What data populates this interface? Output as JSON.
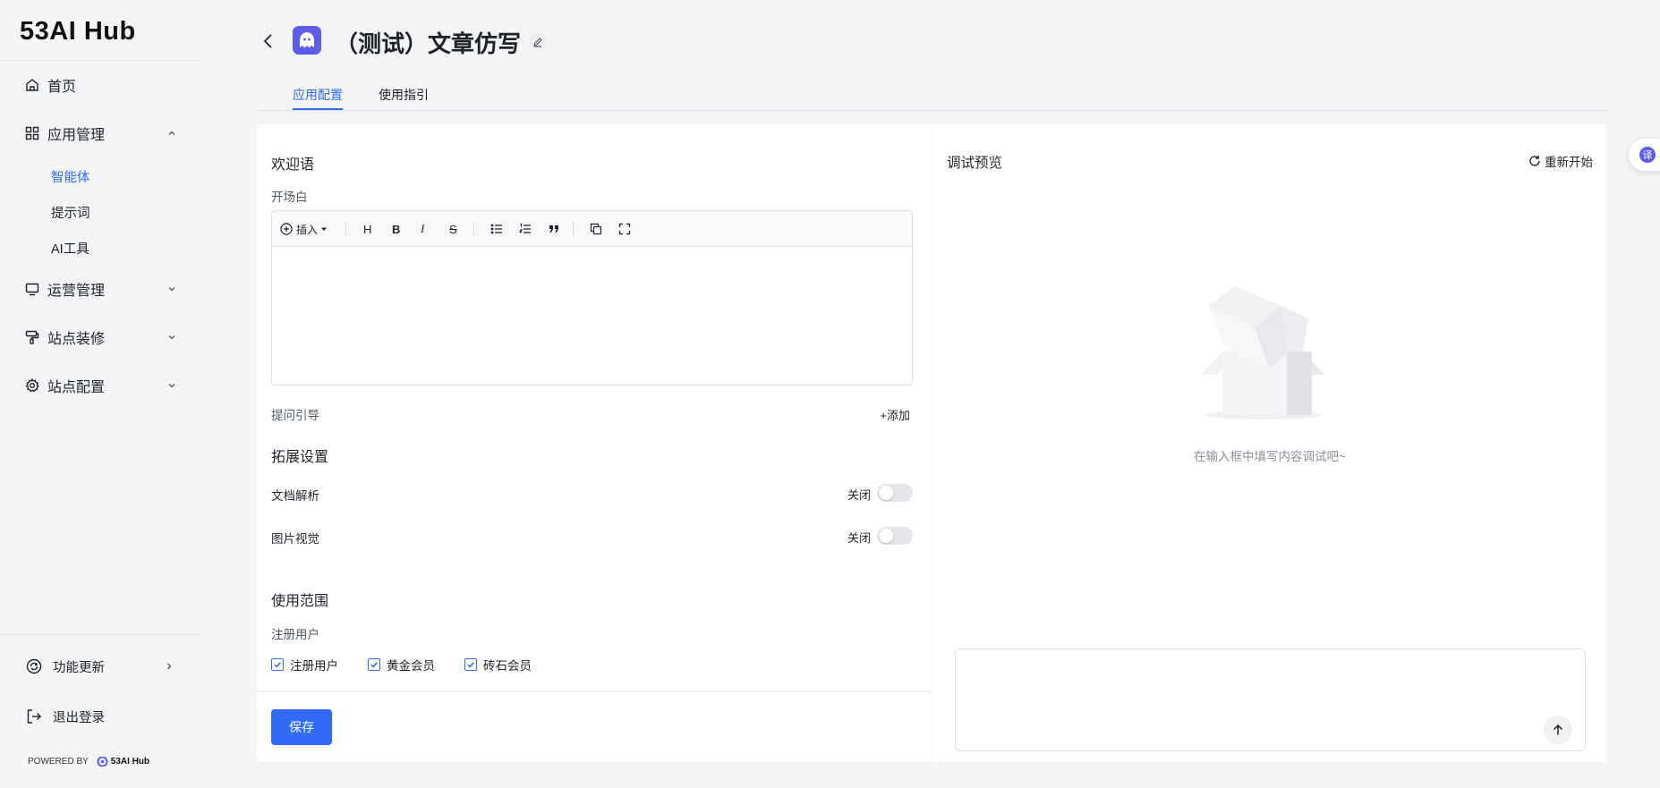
{
  "sidebar": {
    "logo": "53AI Hub",
    "items": [
      {
        "label": "首页",
        "icon": "home-icon"
      },
      {
        "label": "应用管理",
        "icon": "grid-icon",
        "expanded": true
      },
      {
        "label": "运营管理",
        "icon": "monitor-icon",
        "expanded": false
      },
      {
        "label": "站点装修",
        "icon": "paint-roller-icon",
        "expanded": false
      },
      {
        "label": "站点配置",
        "icon": "gear-icon",
        "expanded": false
      }
    ],
    "sub_items": [
      {
        "label": "智能体",
        "active": true
      },
      {
        "label": "提示词",
        "active": false
      },
      {
        "label": "AI工具",
        "active": false
      }
    ],
    "footer": {
      "updates_label": "功能更新",
      "logout_label": "退出登录",
      "powered_by": "POWERED BY",
      "powered_brand": "53AI Hub"
    }
  },
  "header": {
    "title": "（测试）文章仿写",
    "tabs": [
      {
        "label": "应用配置",
        "active": true
      },
      {
        "label": "使用指引",
        "active": false
      }
    ]
  },
  "config": {
    "welcome_title": "欢迎语",
    "opening_label": "开场白",
    "toolbar": {
      "insert_label": "插入",
      "heading": "H",
      "bold": "B",
      "italic": "I",
      "strike": "S"
    },
    "editor_value": "",
    "question_guide_label": "提问引导",
    "add_label": "+添加",
    "extension_title": "拓展设置",
    "doc_parse_label": "文档解析",
    "doc_parse_state": "关闭",
    "image_vision_label": "图片视觉",
    "image_vision_state": "关闭",
    "scope_title": "使用范围",
    "registered_users_label": "注册用户",
    "members": [
      {
        "label": "注册用户",
        "checked": true
      },
      {
        "label": "黄金会员",
        "checked": true
      },
      {
        "label": "砖石会员",
        "checked": true
      }
    ],
    "save_label": "保存"
  },
  "preview": {
    "title": "调试预览",
    "restart_label": "重新开始",
    "empty_text": "在输入框中填写内容调试吧~",
    "input_value": ""
  },
  "fab": {
    "translate_label": "译"
  },
  "colors": {
    "accent": "#2f6bf5",
    "app_avatar": "#5b5ce8"
  }
}
